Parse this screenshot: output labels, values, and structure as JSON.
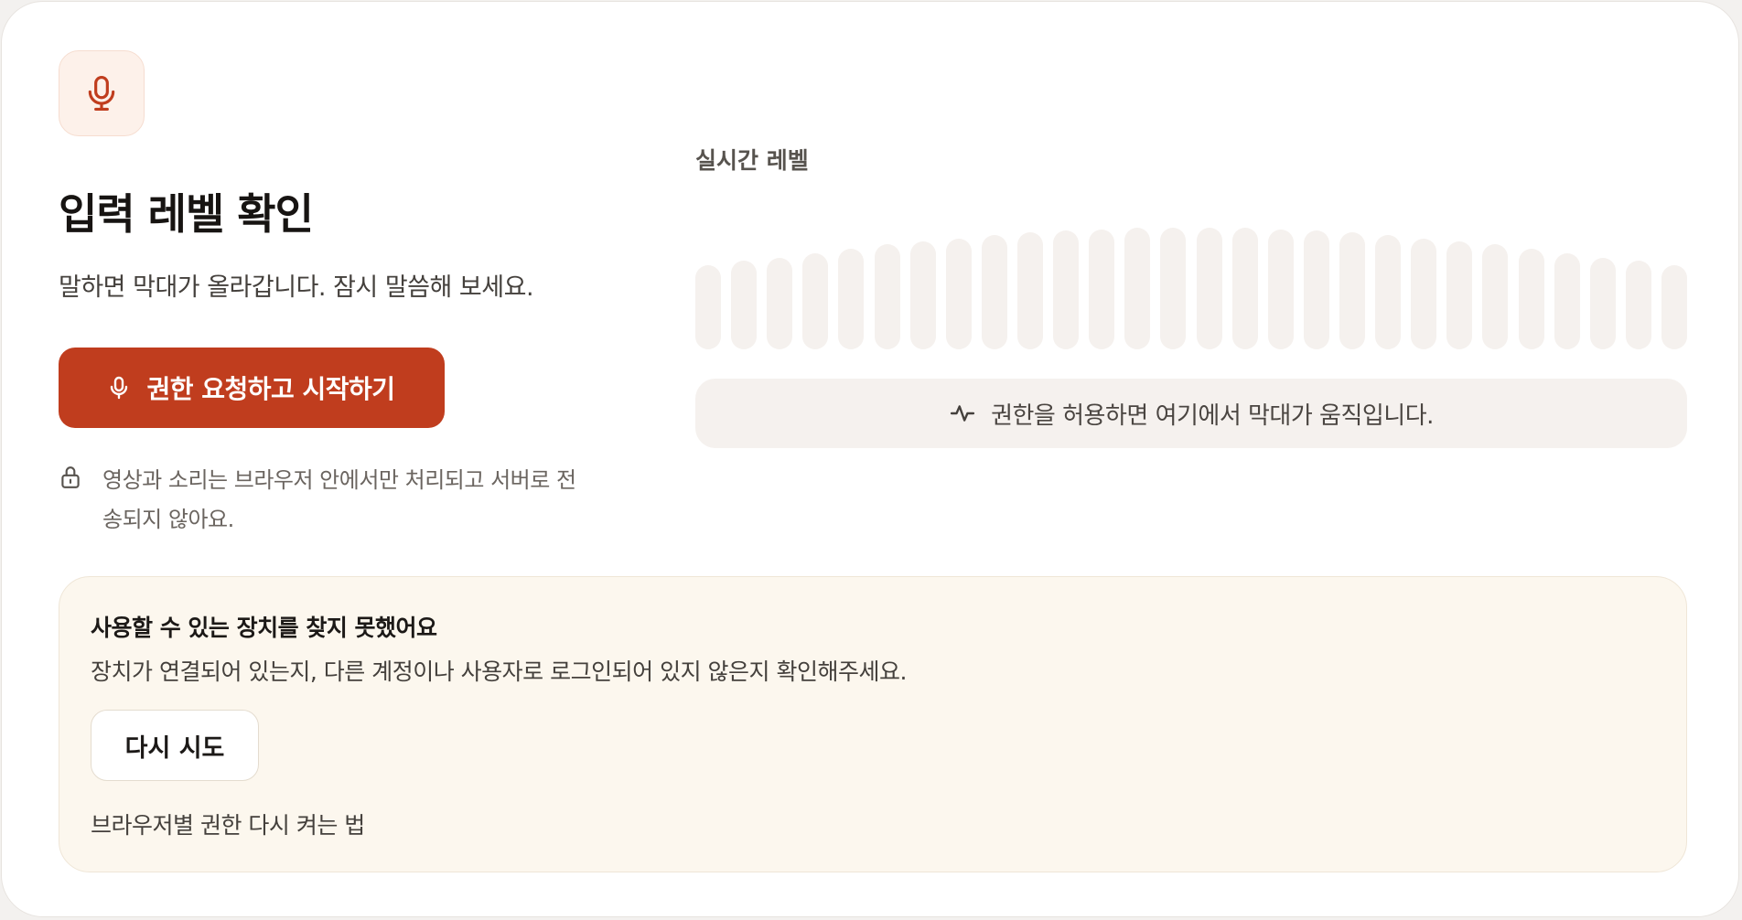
{
  "header": {
    "title": "입력 레벨 확인",
    "subtitle": "말하면 막대가 올라갑니다. 잠시 말씀해 보세요."
  },
  "actions": {
    "start_label": "권한 요청하고 시작하기"
  },
  "privacy": {
    "notice": "영상과 소리는 브라우저 안에서만 처리되고 서버로 전송되지 않아요."
  },
  "meter": {
    "label": "실시간 레벨",
    "status_text": "권한을 허용하면 여기에서 막대가 움직입니다.",
    "bar_levels": [
      0.56,
      0.59,
      0.61,
      0.64,
      0.67,
      0.7,
      0.72,
      0.74,
      0.76,
      0.78,
      0.79,
      0.8,
      0.81,
      0.81,
      0.81,
      0.81,
      0.8,
      0.79,
      0.78,
      0.76,
      0.74,
      0.72,
      0.7,
      0.67,
      0.64,
      0.61,
      0.59,
      0.56
    ]
  },
  "warning": {
    "title": "사용할 수 있는 장치를 찾지 못했어요",
    "message": "장치가 연결되어 있는지, 다른 계정이나 사용자로 로그인되어 있지 않은지 확인해주세요.",
    "retry_label": "다시 시도",
    "help_link": "브라우저별 권한 다시 켜는 법"
  },
  "colors": {
    "accent": "#c03d1e",
    "accent_soft": "#fdf1ea",
    "meter_bar": "#f5f1ee",
    "warning_bg": "#fcf7ee"
  },
  "icons": {
    "header": "microphone-icon",
    "button": "microphone-icon",
    "privacy": "lock-icon",
    "status": "activity-icon"
  }
}
